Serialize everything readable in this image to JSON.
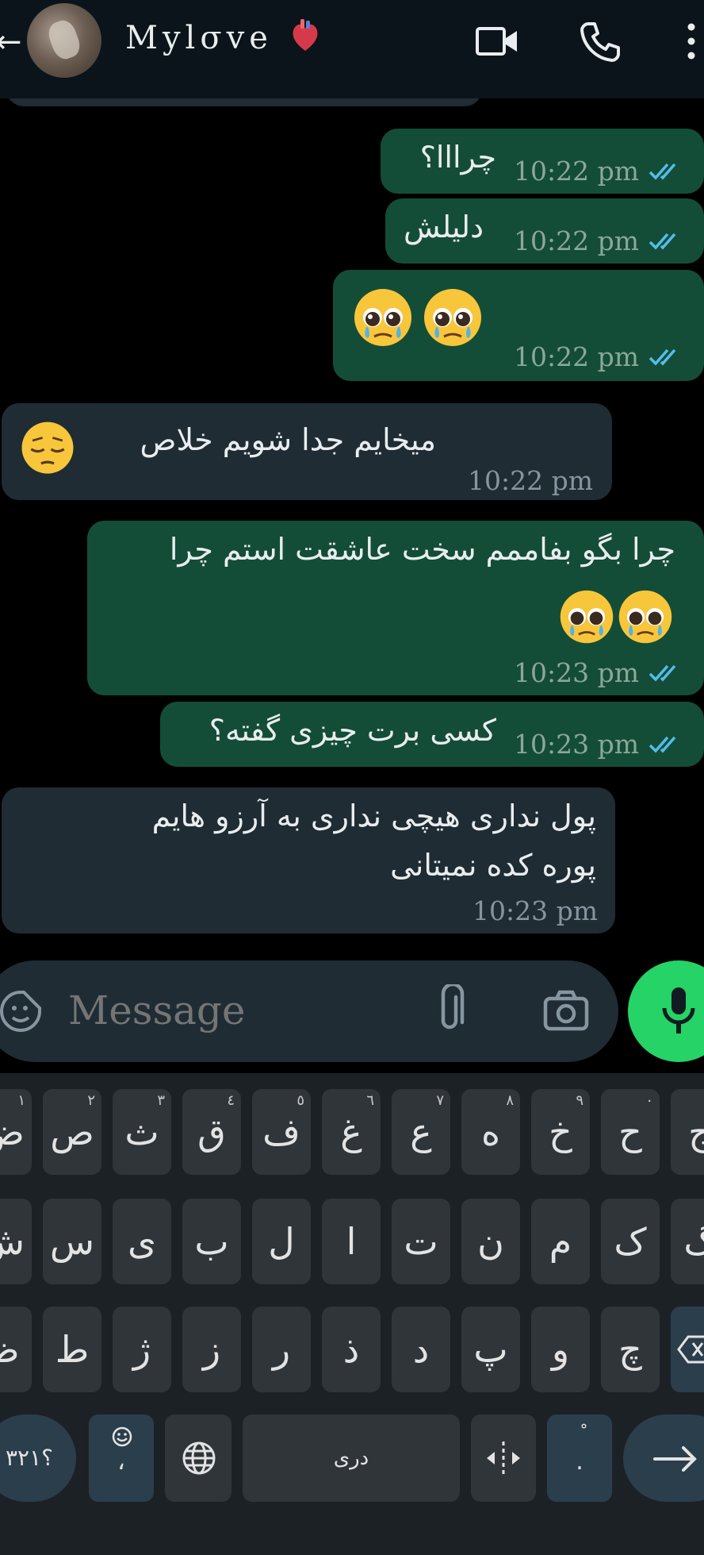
{
  "header": {
    "contact_name": "Mylσve"
  },
  "messages": [
    {
      "dir": "out",
      "text": "چرااا؟",
      "time": "10:22 pm"
    },
    {
      "dir": "out",
      "text": "دلیلش",
      "time": "10:22 pm"
    },
    {
      "dir": "out",
      "text": "",
      "emoji": "pleading-face x2",
      "time": "10:22 pm"
    },
    {
      "dir": "in",
      "text": "میخایم جدا شویم خلاص",
      "emoji": "pensive-face",
      "time": "10:22 pm"
    },
    {
      "dir": "out",
      "text": "چرا بگو بفاممم سخت عاشقت استم چرا",
      "emoji": "pleading-face x2",
      "time": "10:23 pm"
    },
    {
      "dir": "out",
      "text": "کسی برت چیزی گفته؟",
      "time": "10:23 pm"
    },
    {
      "dir": "in",
      "text_line1": "پول نداری هیچی نداری به آرزو هایم",
      "text_line2": "پوره کده نمیتانی",
      "time": "10:23 pm"
    }
  ],
  "composer": {
    "placeholder": "Message"
  },
  "keyboard": {
    "row1": [
      {
        "ch": "ج",
        "hint": ""
      },
      {
        "ch": "ح",
        "hint": "٠"
      },
      {
        "ch": "خ",
        "hint": "٩"
      },
      {
        "ch": "ه",
        "hint": "٨"
      },
      {
        "ch": "ع",
        "hint": "٧"
      },
      {
        "ch": "غ",
        "hint": "٦"
      },
      {
        "ch": "ف",
        "hint": "٥"
      },
      {
        "ch": "ق",
        "hint": "٤"
      },
      {
        "ch": "ث",
        "hint": "٣"
      },
      {
        "ch": "ص",
        "hint": "٢"
      },
      {
        "ch": "ض",
        "hint": "١"
      }
    ],
    "row2": [
      "گ",
      "ک",
      "م",
      "ن",
      "ت",
      "ا",
      "ل",
      "ب",
      "ی",
      "س",
      "ش"
    ],
    "row3": [
      "چ",
      "و",
      "پ",
      "د",
      "ذ",
      "ر",
      "ز",
      "ژ",
      "ط",
      "ظ"
    ],
    "numbers_key": "؟۳۲۱",
    "emoji_key_sub": "،",
    "space_label": "دری",
    "punct_key_sub": "."
  },
  "colors": {
    "outgoing": "#144d37",
    "incoming": "#1f2c34",
    "mic": "#25d366",
    "tick": "#53bdeb"
  }
}
